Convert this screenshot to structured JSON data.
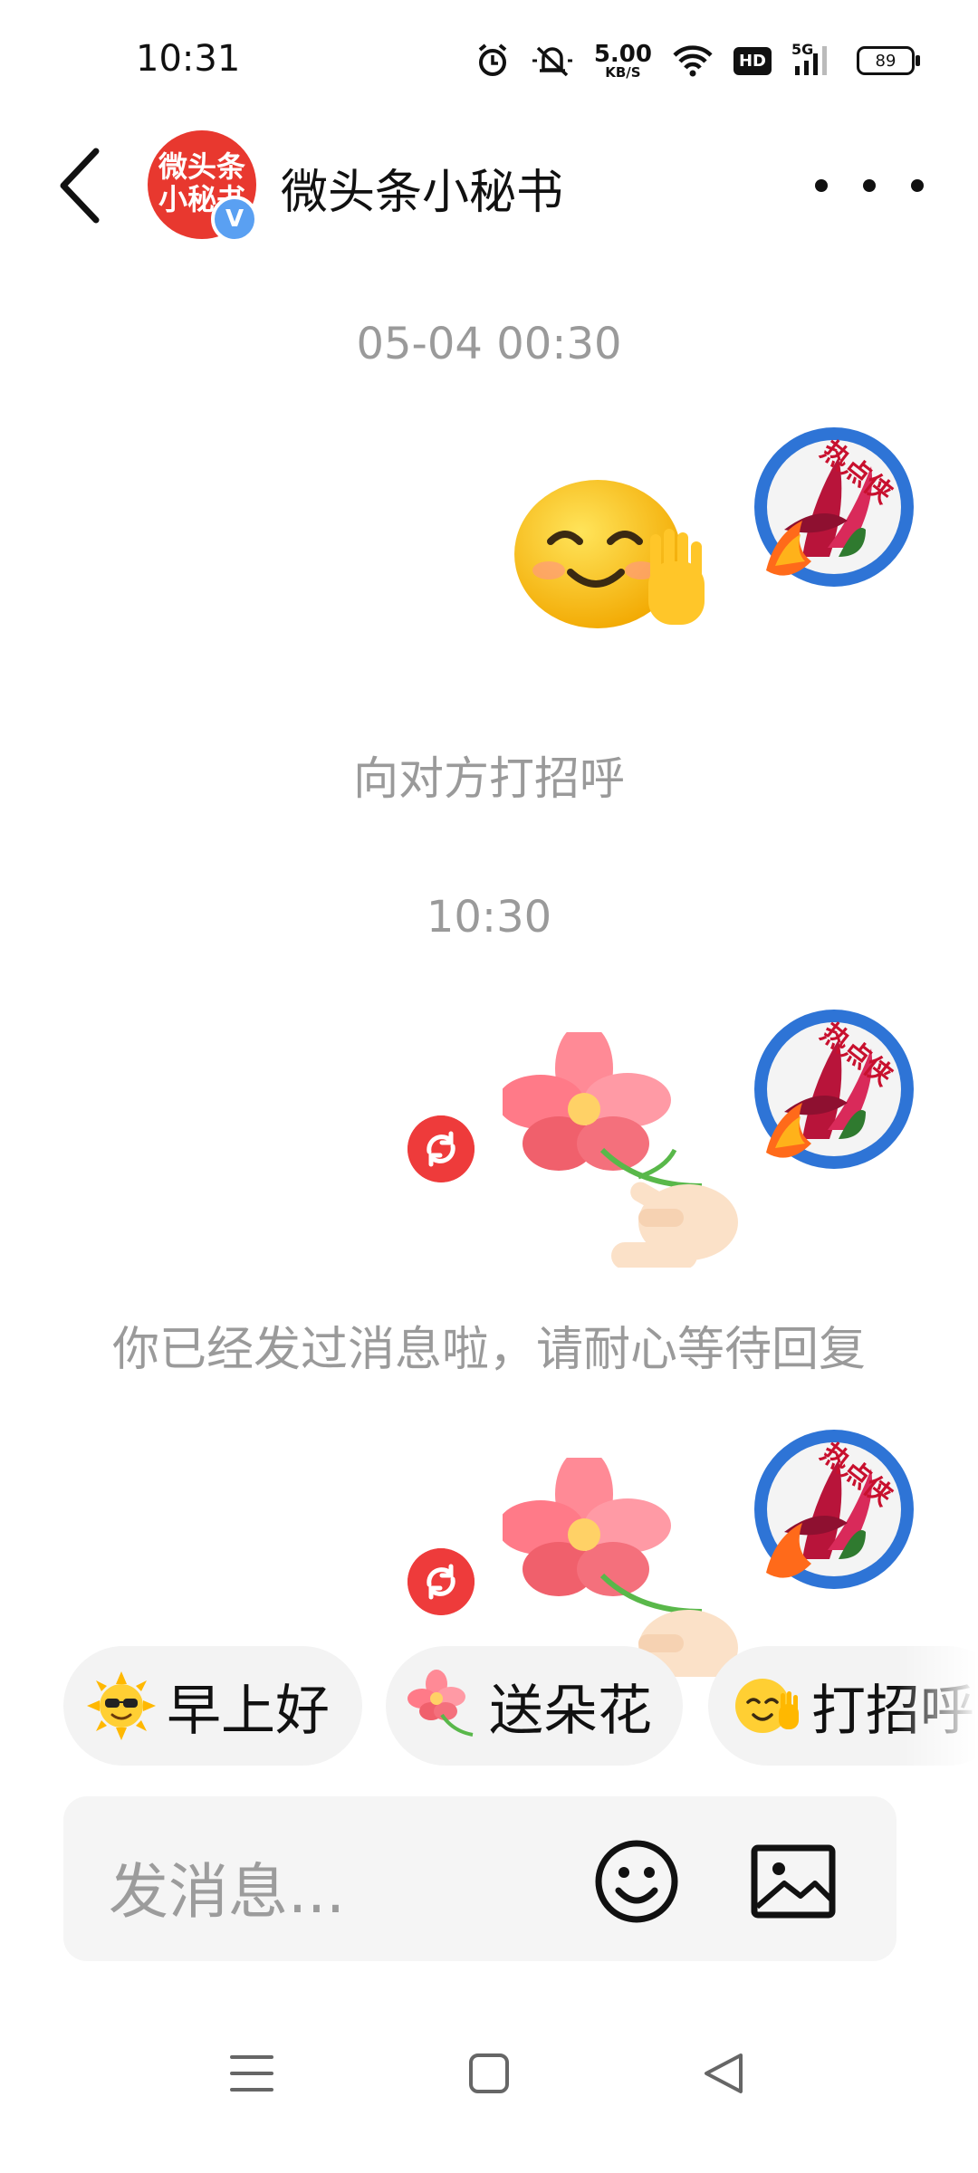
{
  "status_bar": {
    "time": "10:31",
    "net_speed_value": "5.00",
    "net_speed_unit": "KB/S",
    "hd_label": "HD",
    "signal_label": "5G",
    "battery": "89",
    "icons": [
      "alarm-icon",
      "mute-icon",
      "wifi-icon",
      "hd-icon",
      "signal-icon",
      "battery-icon"
    ]
  },
  "header": {
    "back_icon": "chevron-left-icon",
    "avatar_text_line1": "微头条",
    "avatar_text_line2": "小秘书",
    "verified_mark": "V",
    "title": "微头条小秘书",
    "more_icon": "more-horizontal-icon"
  },
  "chat": {
    "timestamp_1": "05-04 00:30",
    "greeting_notice": "向对方打招呼",
    "timestamp_2": "10:30",
    "wait_notice": "你已经发过消息啦，请耐心等待回复",
    "user_avatar_badge": "热点侠",
    "messages": [
      {
        "sticker": "waving-smile-sticker",
        "failed": false
      },
      {
        "sticker": "flower-in-hand-sticker",
        "failed": true
      },
      {
        "sticker": "flower-in-hand-sticker",
        "failed": true
      }
    ]
  },
  "quick_replies": [
    {
      "icon": "sun-sunglasses-icon",
      "label": "早上好"
    },
    {
      "icon": "flower-icon",
      "label": "送朵花"
    },
    {
      "icon": "waving-smile-icon",
      "label": "打招呼"
    }
  ],
  "input": {
    "placeholder": "发消息...",
    "emoji_icon": "smiley-icon",
    "image_icon": "image-icon"
  },
  "nav_bar": {
    "buttons": [
      "menu-icon",
      "home-square-icon",
      "back-triangle-icon"
    ]
  },
  "colors": {
    "accent_red": "#e8382f",
    "verified_blue": "#5aa0f2",
    "grey_text": "#9a9a9a",
    "chip_bg": "#f3f3f3"
  }
}
